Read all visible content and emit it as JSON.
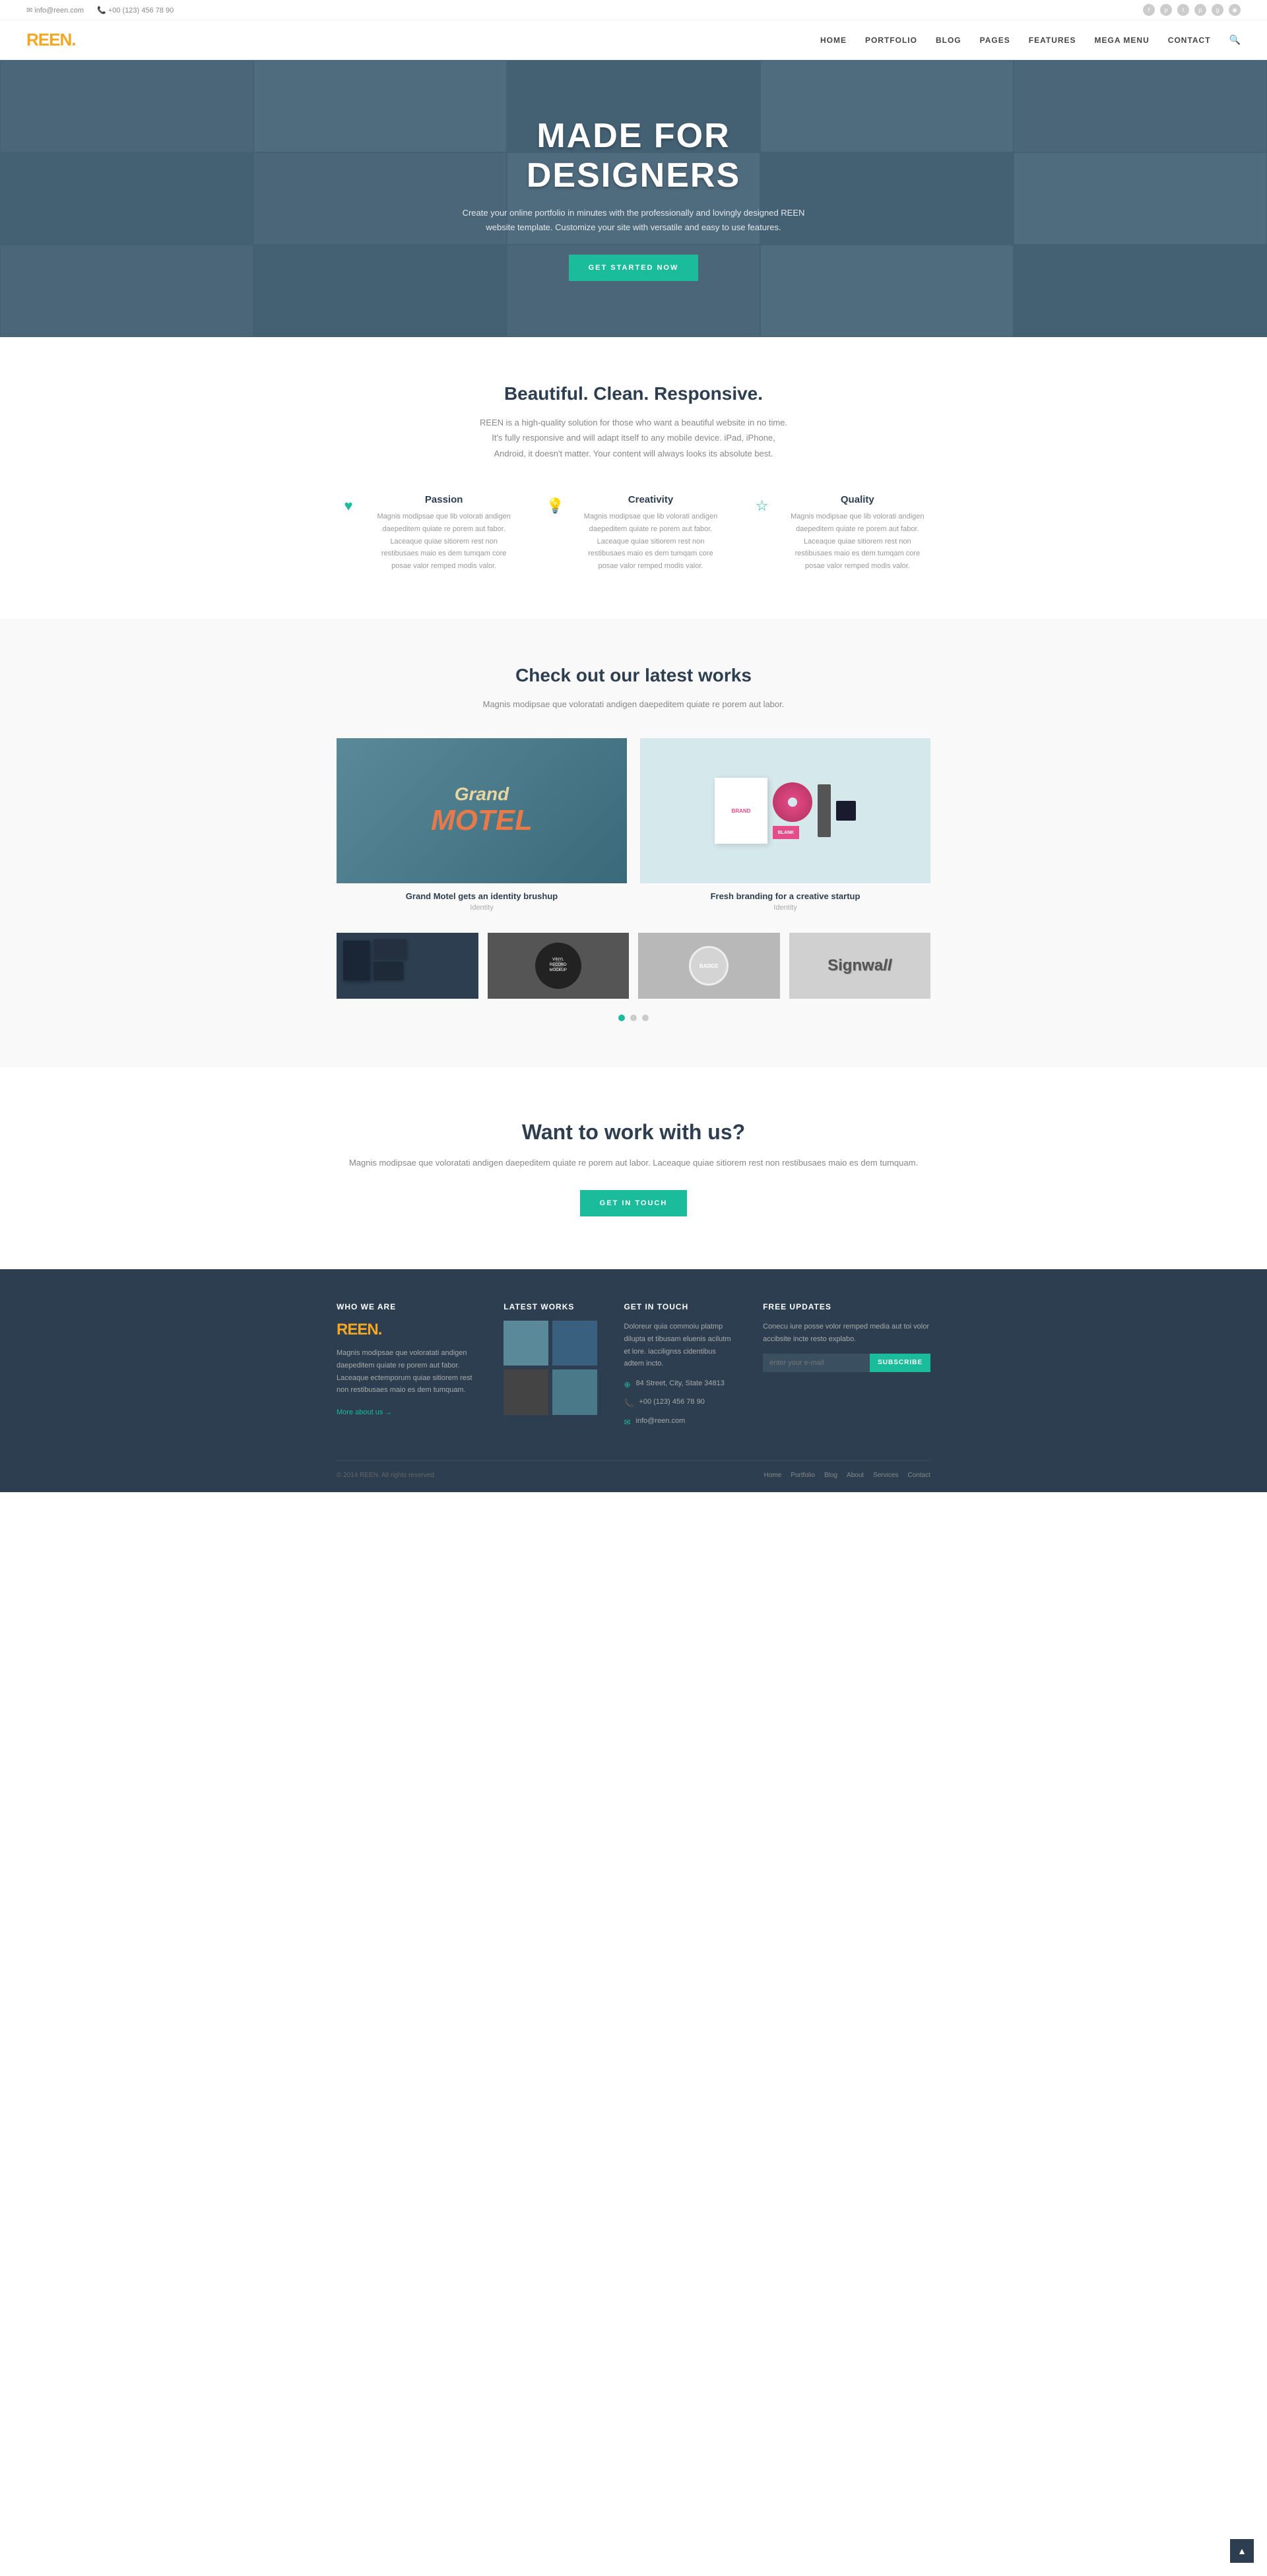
{
  "topbar": {
    "email_icon": "✉",
    "email": "info@reen.com",
    "phone_icon": "📞",
    "phone": "+00 (123) 456 78 90",
    "socials": [
      "f",
      "p",
      "t",
      "p",
      "p",
      "◉"
    ]
  },
  "header": {
    "logo": "REEN",
    "logo_dot": ".",
    "nav": [
      "HOME",
      "PORTFOLIO",
      "BLOG",
      "PAGES",
      "FEATURES",
      "MEGA MENU",
      "CONTACT"
    ]
  },
  "hero": {
    "title": "MADE FOR DESIGNERS",
    "subtitle": "Create your online portfolio in minutes with the professionally and lovingly designed REEN website template. Customize your site with versatile and easy to use features.",
    "cta_label": "GET STARTED NOW"
  },
  "features_section": {
    "title": "Beautiful. Clean. Responsive.",
    "subtitle": "REEN is a high-quality solution for those who want a beautiful website in no time. It's fully responsive and will adapt itself to any mobile device. iPad, iPhone, Android, it doesn't matter. Your content will always looks its absolute best.",
    "items": [
      {
        "icon": "♥",
        "title": "Passion",
        "text": "Magnis modipsae que lib volorati andigen daepeditem quiate re porem aut fabor. Laceaque quiae sitiorem rest non restibusaes maio es dem tumqam core posae valor remped modis valor."
      },
      {
        "icon": "💡",
        "title": "Creativity",
        "text": "Magnis modipsae que lib volorati andigen daepeditem quiate re porem aut fabor. Laceaque quiae sitiorem rest non restibusaes maio es dem tumqam core posae valor remped modis valor."
      },
      {
        "icon": "☆",
        "title": "Quality",
        "text": "Magnis modipsae que lib volorati andigen daepeditem quiate re porem aut fabor. Laceaque quiae sitiorem rest non restibusaes maio es dem tumqam core posae valor remped modis valor."
      }
    ]
  },
  "portfolio_section": {
    "title": "Check out our latest works",
    "subtitle": "Magnis modipsae que voloratati andigen daepeditem quiate re porem aut labor.",
    "items_large": [
      {
        "title": "Grand Motel gets an identity brushup",
        "category": "Identity"
      },
      {
        "title": "Fresh branding for a creative startup",
        "category": "Identity"
      }
    ],
    "dots": [
      true,
      false,
      false
    ]
  },
  "cta_section": {
    "title": "Want to work with us?",
    "text": "Magnis modipsae que voloratati andigen daepeditem quiate re porem aut labor.\nLaceaque quiae sitiorem rest non restibusaes maio es dem tumquam.",
    "btn_label": "GET IN TOUCH"
  },
  "footer": {
    "logo": "REEN",
    "logo_dot": ".",
    "desc": "Magnis modipsae que voloratati andigen daepeditem quiate re porem aut fabor. Laceaque ectemporum quiae sitiorem rest non restibusaes maio es dem tumquam.",
    "more_label": "More about us →",
    "col1_title": "WHO WE ARE",
    "col2_title": "LATEST WORKS",
    "col3_title": "GET IN TOUCH",
    "col4_title": "FREE UPDATES",
    "contact_text": "Doloreur quia commoiu platmp dilupta et tibusam eluenis acilutm et lore. iaccilignss cidentibus adtem incto.",
    "address_icon": "⊕",
    "address": "84 Street, City, State 34813",
    "phone_icon": "📞",
    "phone": "+00 (123) 456 78 90",
    "email_icon": "✉",
    "email": "info@reen.com",
    "update_text": "Conecu iure posse volor remped media aut toi volor accibsite incte resto explabo.",
    "subscribe_placeholder": "enter your e-mail",
    "subscribe_label": "SUBSCRIBE",
    "copyright": "© 2014 REEN. All rights reserved.",
    "footer_nav": [
      "Home",
      "Portfolio",
      "Blog",
      "About",
      "Services",
      "Contact"
    ]
  }
}
